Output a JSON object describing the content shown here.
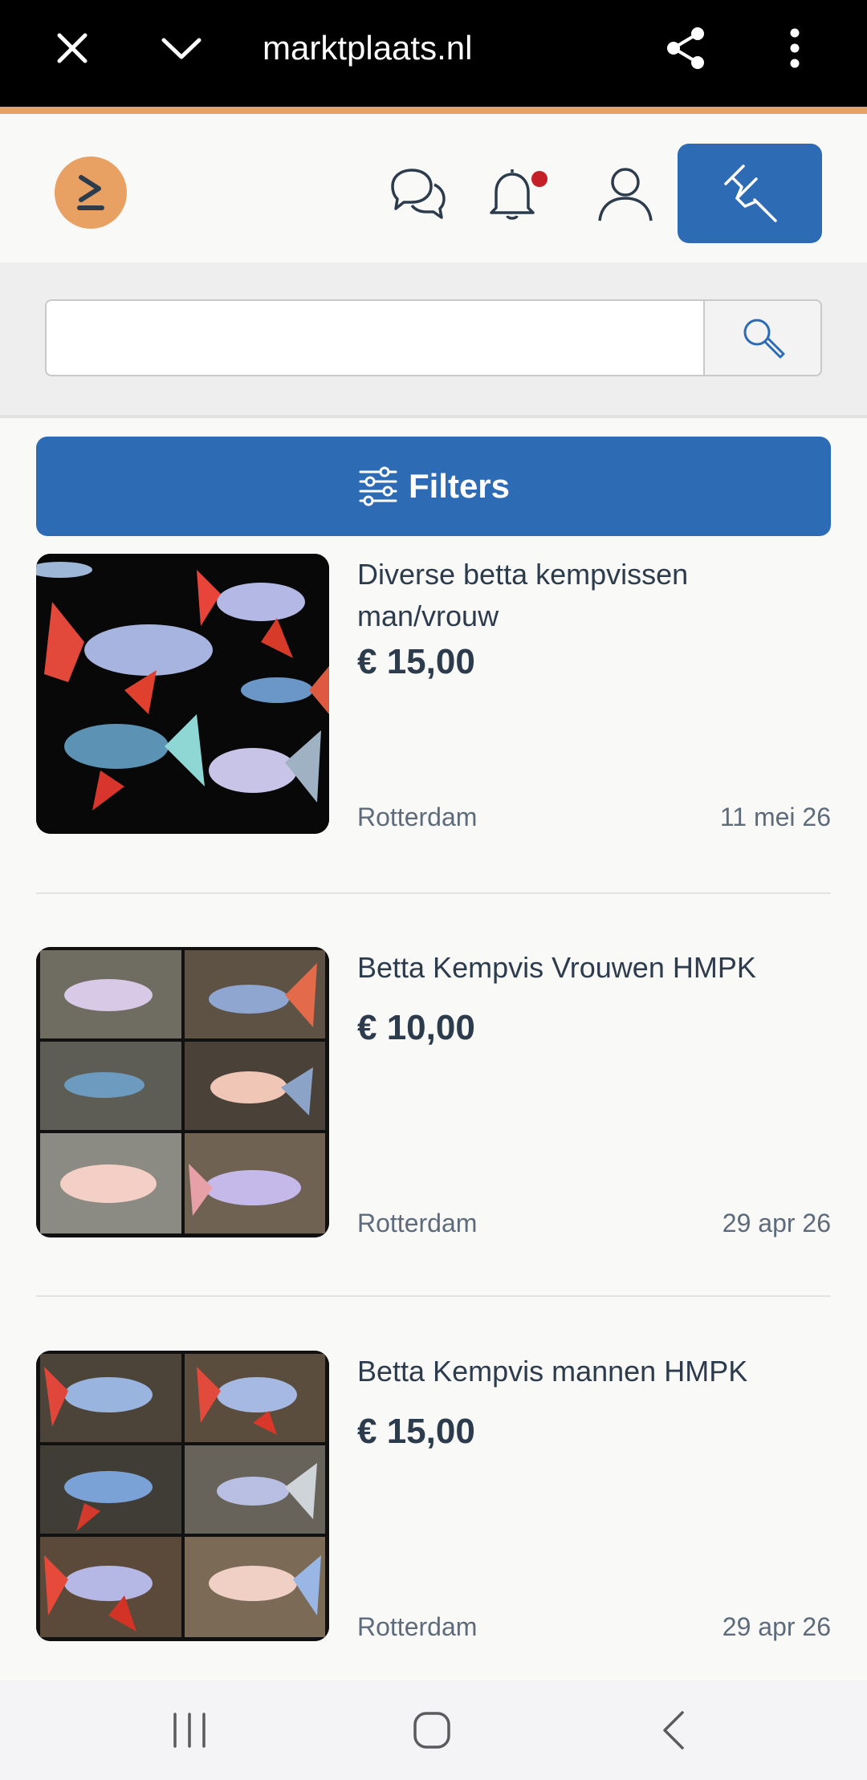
{
  "browser": {
    "url": "marktplaats.nl",
    "close_icon": "close-icon",
    "collapse_icon": "chevron-down-icon",
    "share_icon": "share-icon",
    "menu_icon": "more-vert-icon"
  },
  "header": {
    "logo_icon": "marktplaats-logo",
    "messages_icon": "chat-bubbles-icon",
    "notifications_icon": "bell-icon",
    "profile_icon": "user-icon",
    "post_icon": "pin-icon"
  },
  "search": {
    "value": "",
    "placeholder": "",
    "search_icon": "magnifier-icon"
  },
  "filters": {
    "label": "Filters",
    "icon": "sliders-icon"
  },
  "listings": [
    {
      "title": "Diverse betta kempvissen man/vrouw",
      "price": "€ 15,00",
      "location": "Rotterdam",
      "date": "11 mei 26"
    },
    {
      "title": "Betta Kempvis Vrouwen HMPK",
      "price": "€ 10,00",
      "location": "Rotterdam",
      "date": "29 apr 26"
    },
    {
      "title": "Betta Kempvis mannen HMPK",
      "price": "€ 15,00",
      "location": "Rotterdam",
      "date": "29 apr 26"
    }
  ],
  "system_nav": {
    "recents_icon": "recents-icon",
    "home_icon": "home-icon",
    "back_icon": "back-icon"
  },
  "colors": {
    "brand_blue": "#2d6bb5",
    "brand_orange": "#e8a063",
    "text_dark": "#2d3c4d",
    "text_muted": "#5d6b7a",
    "notification_red": "#c51f27"
  }
}
